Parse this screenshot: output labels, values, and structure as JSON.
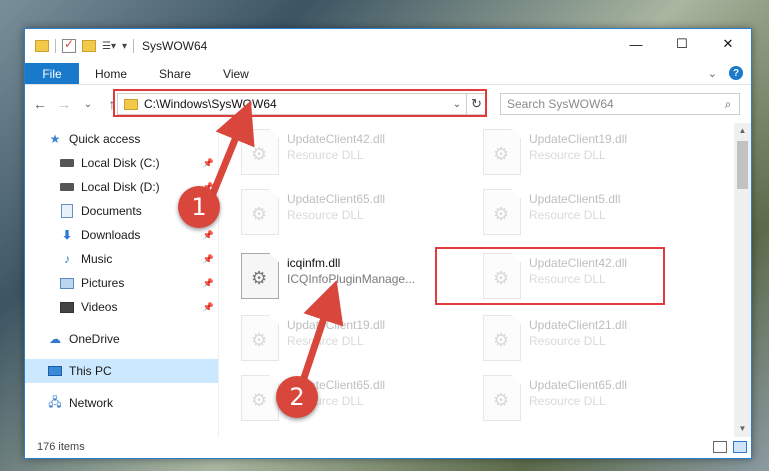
{
  "window": {
    "title": "SysWOW64",
    "controls": {
      "minimize": "—",
      "maximize": "☐",
      "close": "✕"
    }
  },
  "ribbon": {
    "tabs": [
      {
        "label": "File",
        "active": true
      },
      {
        "label": "Home"
      },
      {
        "label": "Share"
      },
      {
        "label": "View"
      }
    ],
    "expand_icon": "chevron-down-icon",
    "help_label": "?"
  },
  "nav": {
    "back": "←",
    "forward": "→",
    "recent": "⌄",
    "up": "↑",
    "address": "C:\\Windows\\SysWOW64",
    "address_dropdown": "⌄",
    "refresh": "↻",
    "search_placeholder": "Search SysWOW64",
    "search_icon": "⌕"
  },
  "sidebar": {
    "items": [
      {
        "label": "Quick access",
        "icon": "star-icon",
        "pinned": false
      },
      {
        "label": "Local Disk (C:)",
        "icon": "drive-icon",
        "pinned": true
      },
      {
        "label": "Local Disk (D:)",
        "icon": "drive-icon",
        "pinned": true
      },
      {
        "label": "Documents",
        "icon": "document-icon",
        "pinned": true
      },
      {
        "label": "Downloads",
        "icon": "download-icon",
        "pinned": true
      },
      {
        "label": "Music",
        "icon": "music-icon",
        "pinned": true
      },
      {
        "label": "Pictures",
        "icon": "pictures-icon",
        "pinned": true
      },
      {
        "label": "Videos",
        "icon": "videos-icon",
        "pinned": true
      },
      {
        "label": "OneDrive",
        "icon": "cloud-icon",
        "pinned": false
      },
      {
        "label": "This PC",
        "icon": "computer-icon",
        "pinned": false,
        "selected": true
      },
      {
        "label": "Network",
        "icon": "network-icon",
        "pinned": false
      }
    ]
  },
  "files": [
    {
      "name": "UpdateClient42.dll",
      "desc": "Resource DLL",
      "faded": true
    },
    {
      "name": "UpdateClient19.dll",
      "desc": "Resource DLL",
      "faded": true
    },
    {
      "name": "UpdateClient65.dll",
      "desc": "Resource DLL",
      "faded": true
    },
    {
      "name": "UpdateClient5.dll",
      "desc": "Resource DLL",
      "faded": true
    },
    {
      "name": "icqinfm.dll",
      "desc": "ICQInfoPluginManage...",
      "faded": false,
      "highlighted": true
    },
    {
      "name": "UpdateClient42.dll",
      "desc": "Resource DLL",
      "faded": true
    },
    {
      "name": "UpdateClient19.dll",
      "desc": "Resource DLL",
      "faded": true
    },
    {
      "name": "UpdateClient21.dll",
      "desc": "Resource DLL",
      "faded": true
    },
    {
      "name": "UpdateClient65.dll",
      "desc": "Resource DLL",
      "faded": true
    },
    {
      "name": "UpdateClient65.dll",
      "desc": "Resource DLL",
      "faded": true
    }
  ],
  "status": {
    "item_count": "176 items"
  },
  "callouts": [
    {
      "label": "1"
    },
    {
      "label": "2"
    }
  ],
  "colors": {
    "accent": "#1979ca",
    "highlight": "#e23b3b",
    "callout": "#d9473c"
  }
}
